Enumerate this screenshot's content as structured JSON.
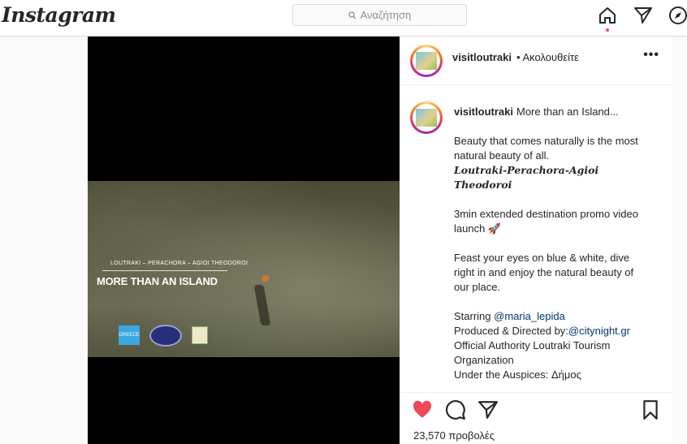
{
  "header": {
    "logo": "Instagram",
    "search_placeholder": "Αναζήτηση"
  },
  "post": {
    "video": {
      "subtitle": "LOUTRAKI – PERACHORA – AGIOI THEODOROI",
      "title": "MORE THAN AN ISLAND",
      "logo1_text": "GREECE"
    },
    "author": {
      "username": "visitloutraki",
      "follow_status": "• Ακολουθείτε"
    },
    "caption": {
      "username": "visitloutraki",
      "first_line": "More than an Island...",
      "paragraphs": {
        "p1": "Beauty that comes naturally is the most natural beauty of all.",
        "p1_italic": "Loutraki-Perachora-Agioi Theodoroi",
        "p2": "3min extended destination promo video launch 🚀",
        "p3": "Feast your eyes on blue & white, dive right in and enjoy the natural beauty of our place.",
        "starring_label": "Starring",
        "starring_link": "@maria_lepida",
        "produced_label": "Produced & Directed by:",
        "produced_link": "@citynight.gr",
        "official": "Official Authority Loutraki Tourism Organization",
        "auspices": "Under the Auspices: Δήμος"
      }
    },
    "views": "23,570 προβολές"
  },
  "icons": {
    "home": "home-icon",
    "direct": "paper-plane-icon",
    "explore": "compass-icon",
    "like": "heart-icon",
    "comment": "comment-icon",
    "share": "share-icon",
    "save": "bookmark-icon"
  },
  "colors": {
    "like_red": "#ed4956",
    "link_blue": "#00376b"
  }
}
